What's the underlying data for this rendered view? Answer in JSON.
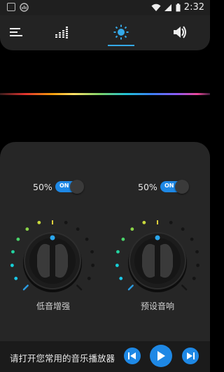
{
  "status_bar": {
    "time": "2:32"
  },
  "tabs": [
    {
      "icon": "menu-icon"
    },
    {
      "icon": "equalizer-icon"
    },
    {
      "icon": "brightness-icon",
      "active": true
    },
    {
      "icon": "speaker-icon"
    }
  ],
  "controls": {
    "bass_boost": {
      "percent_label": "50%",
      "toggle_label": "ON",
      "label": "低音增强",
      "level": 0.5
    },
    "preset_sound": {
      "percent_label": "50%",
      "toggle_label": "ON",
      "label": "预设音响",
      "level": 0.5
    }
  },
  "bottom_bar": {
    "hint": "请打开您常用的音乐播放器"
  },
  "colors": {
    "accent": "#1e88e5",
    "underline": "#35a9e8",
    "panel": "#262626"
  }
}
